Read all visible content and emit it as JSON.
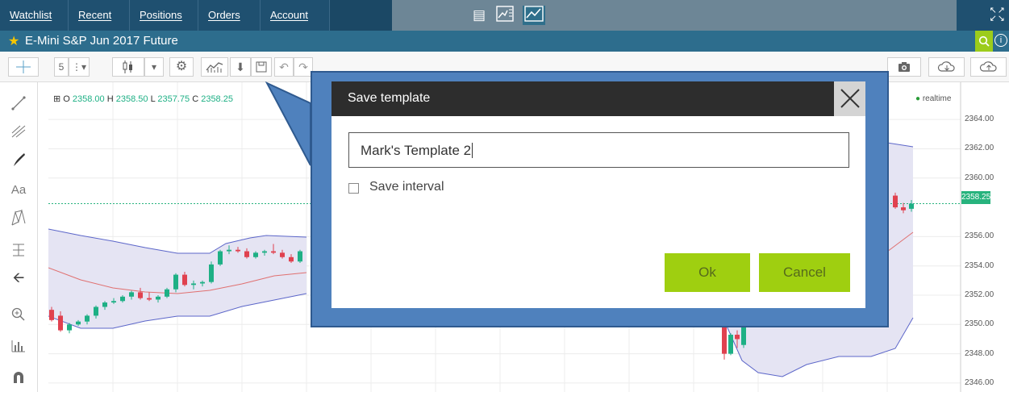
{
  "topnav": {
    "tabs": [
      "Watchlist",
      "Recent",
      "Positions",
      "Orders",
      "Account"
    ],
    "view_icons": [
      "document-icon",
      "chart-list-icon",
      "line-chart-icon"
    ],
    "active_view": "line-chart-icon",
    "expand_icon": "fullscreen-expand-icon"
  },
  "titlebar": {
    "title": "E-Mini S&P Jun 2017 Future",
    "favorite_icon": "star-icon",
    "search_icon": "search-icon",
    "info_icon": "info-icon"
  },
  "toolbar": {
    "interval": "5",
    "icons": [
      "interval-dropdown-icon",
      "candlestick-icon",
      "chart-type-dropdown-icon",
      "gear-icon",
      "indicators-icon",
      "download-icon",
      "save-icon",
      "undo-icon",
      "redo-icon",
      "camera-icon",
      "cloud-download-icon",
      "cloud-upload-icon"
    ]
  },
  "left_tools": [
    "crosshair-icon",
    "trendline-icon",
    "fib-icon",
    "brush-icon",
    "text-icon",
    "pattern-icon",
    "measure-icon",
    "arrow-left-icon",
    "zoom-in-icon",
    "volume-profile-icon",
    "magnet-icon"
  ],
  "left_tool_text": {
    "text_tool": "Aa"
  },
  "ohlc": {
    "o_label": "O",
    "o": "2358.00",
    "h_label": "H",
    "h": "2358.50",
    "l_label": "L",
    "l": "2357.75",
    "c_label": "C",
    "c": "2358.25"
  },
  "realtime": "realtime",
  "colors": {
    "nav_bg": "#1f5070",
    "title_bg": "#2d6d8d",
    "accent_green": "#9ccc1b",
    "callout_blue": "#4f81bd",
    "up_candle": "#1eb085",
    "down_candle": "#e0414f",
    "band_fill": "#e5e4f3",
    "band_line": "#5c66c9",
    "ma_line": "#e07070"
  },
  "chart_data": {
    "type": "candlestick",
    "title": "",
    "y_ticks": [
      "2364.00",
      "2362.00",
      "2360.00",
      "2358.25",
      "2356.00",
      "2354.00",
      "2352.00",
      "2350.00",
      "2348.00",
      "2346.00"
    ],
    "ylim": [
      2345.5,
      2365
    ],
    "last_price": "2358.25",
    "grid": true,
    "candles_left": [
      {
        "o": 2351.0,
        "h": 2351.2,
        "l": 2350.2,
        "c": 2350.3
      },
      {
        "o": 2350.6,
        "h": 2350.9,
        "l": 2349.5,
        "c": 2349.6
      },
      {
        "o": 2349.6,
        "h": 2350.1,
        "l": 2349.4,
        "c": 2350.0
      },
      {
        "o": 2350.0,
        "h": 2350.3,
        "l": 2349.9,
        "c": 2350.2
      },
      {
        "o": 2350.2,
        "h": 2350.7,
        "l": 2350.0,
        "c": 2350.6
      },
      {
        "o": 2350.6,
        "h": 2351.3,
        "l": 2350.4,
        "c": 2351.2
      },
      {
        "o": 2351.2,
        "h": 2351.6,
        "l": 2351.0,
        "c": 2351.5
      },
      {
        "o": 2351.5,
        "h": 2351.8,
        "l": 2351.4,
        "c": 2351.6
      },
      {
        "o": 2351.6,
        "h": 2352.0,
        "l": 2351.5,
        "c": 2351.9
      },
      {
        "o": 2351.9,
        "h": 2352.3,
        "l": 2351.7,
        "c": 2352.2
      },
      {
        "o": 2352.2,
        "h": 2352.5,
        "l": 2351.7,
        "c": 2351.8
      },
      {
        "o": 2351.8,
        "h": 2352.2,
        "l": 2351.6,
        "c": 2351.7
      },
      {
        "o": 2351.7,
        "h": 2352.0,
        "l": 2351.5,
        "c": 2351.9
      },
      {
        "o": 2351.9,
        "h": 2352.5,
        "l": 2351.8,
        "c": 2352.4
      },
      {
        "o": 2352.4,
        "h": 2353.5,
        "l": 2352.2,
        "c": 2353.4
      },
      {
        "o": 2353.4,
        "h": 2353.6,
        "l": 2352.6,
        "c": 2352.7
      },
      {
        "o": 2352.7,
        "h": 2353.0,
        "l": 2352.4,
        "c": 2352.8
      },
      {
        "o": 2352.8,
        "h": 2353.0,
        "l": 2352.6,
        "c": 2352.9
      },
      {
        "o": 2352.9,
        "h": 2354.3,
        "l": 2352.8,
        "c": 2354.1
      },
      {
        "o": 2354.1,
        "h": 2355.1,
        "l": 2354.0,
        "c": 2355.0
      },
      {
        "o": 2355.0,
        "h": 2355.4,
        "l": 2354.8,
        "c": 2355.1
      },
      {
        "o": 2355.1,
        "h": 2355.3,
        "l": 2354.9,
        "c": 2355.0
      },
      {
        "o": 2355.0,
        "h": 2355.2,
        "l": 2354.5,
        "c": 2354.6
      },
      {
        "o": 2354.6,
        "h": 2355.0,
        "l": 2354.5,
        "c": 2354.9
      },
      {
        "o": 2354.9,
        "h": 2355.1,
        "l": 2354.7,
        "c": 2355.0
      },
      {
        "o": 2355.0,
        "h": 2355.5,
        "l": 2354.8,
        "c": 2354.9
      },
      {
        "o": 2354.9,
        "h": 2355.1,
        "l": 2354.5,
        "c": 2354.6
      },
      {
        "o": 2354.6,
        "h": 2354.8,
        "l": 2354.2,
        "c": 2354.3
      },
      {
        "o": 2354.3,
        "h": 2355.1,
        "l": 2354.2,
        "c": 2355.0
      }
    ],
    "candles_right": [
      {
        "o": 2349.8,
        "h": 2350.0,
        "l": 2347.6,
        "c": 2348.0
      },
      {
        "o": 2348.0,
        "h": 2349.4,
        "l": 2347.9,
        "c": 2349.3
      },
      {
        "o": 2349.3,
        "h": 2349.6,
        "l": 2348.4,
        "c": 2349.0
      },
      {
        "o": 2348.6,
        "h": 2349.9,
        "l": 2348.4,
        "c": 2349.8
      }
    ],
    "candles_far_right": [
      {
        "o": 2358.8,
        "h": 2359.0,
        "l": 2357.9,
        "c": 2358.0
      },
      {
        "o": 2358.0,
        "h": 2358.3,
        "l": 2357.6,
        "c": 2357.8
      },
      {
        "o": 2357.9,
        "h": 2358.5,
        "l": 2357.7,
        "c": 2358.25
      }
    ]
  },
  "dialog": {
    "title": "Save template",
    "input_value": "Mark's Template 2",
    "checkbox_label": "Save interval",
    "checkbox_checked": false,
    "ok_label": "Ok",
    "cancel_label": "Cancel",
    "close_icon": "close-icon"
  }
}
